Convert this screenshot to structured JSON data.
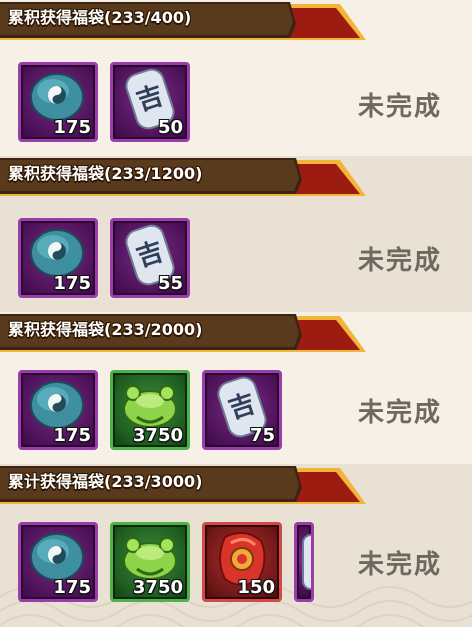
{
  "tasks": [
    {
      "title": "累积获得福袋(233/400)",
      "status": "未完成",
      "rewards": [
        {
          "icon": "taiji-stone-icon",
          "count": "175"
        },
        {
          "icon": "ji-talisman-icon",
          "count": "50"
        }
      ]
    },
    {
      "title": "累积获得福袋(233/1200)",
      "status": "未完成",
      "rewards": [
        {
          "icon": "taiji-stone-icon",
          "count": "175"
        },
        {
          "icon": "ji-talisman-icon",
          "count": "55"
        }
      ]
    },
    {
      "title": "累积获得福袋(233/2000)",
      "status": "未完成",
      "rewards": [
        {
          "icon": "taiji-stone-icon",
          "count": "175"
        },
        {
          "icon": "green-beast-icon",
          "count": "3750"
        },
        {
          "icon": "ji-talisman-icon",
          "count": "75"
        }
      ]
    },
    {
      "title": "累计获得福袋(233/3000)",
      "status": "未完成",
      "rewards": [
        {
          "icon": "taiji-stone-icon",
          "count": "175"
        },
        {
          "icon": "green-beast-icon",
          "count": "3750"
        },
        {
          "icon": "red-gem-icon",
          "count": "150"
        }
      ]
    }
  ],
  "colors": {
    "banner_red": "#9c1c12",
    "banner_gold": "#f2b53a",
    "status_text": "#6f6860"
  }
}
